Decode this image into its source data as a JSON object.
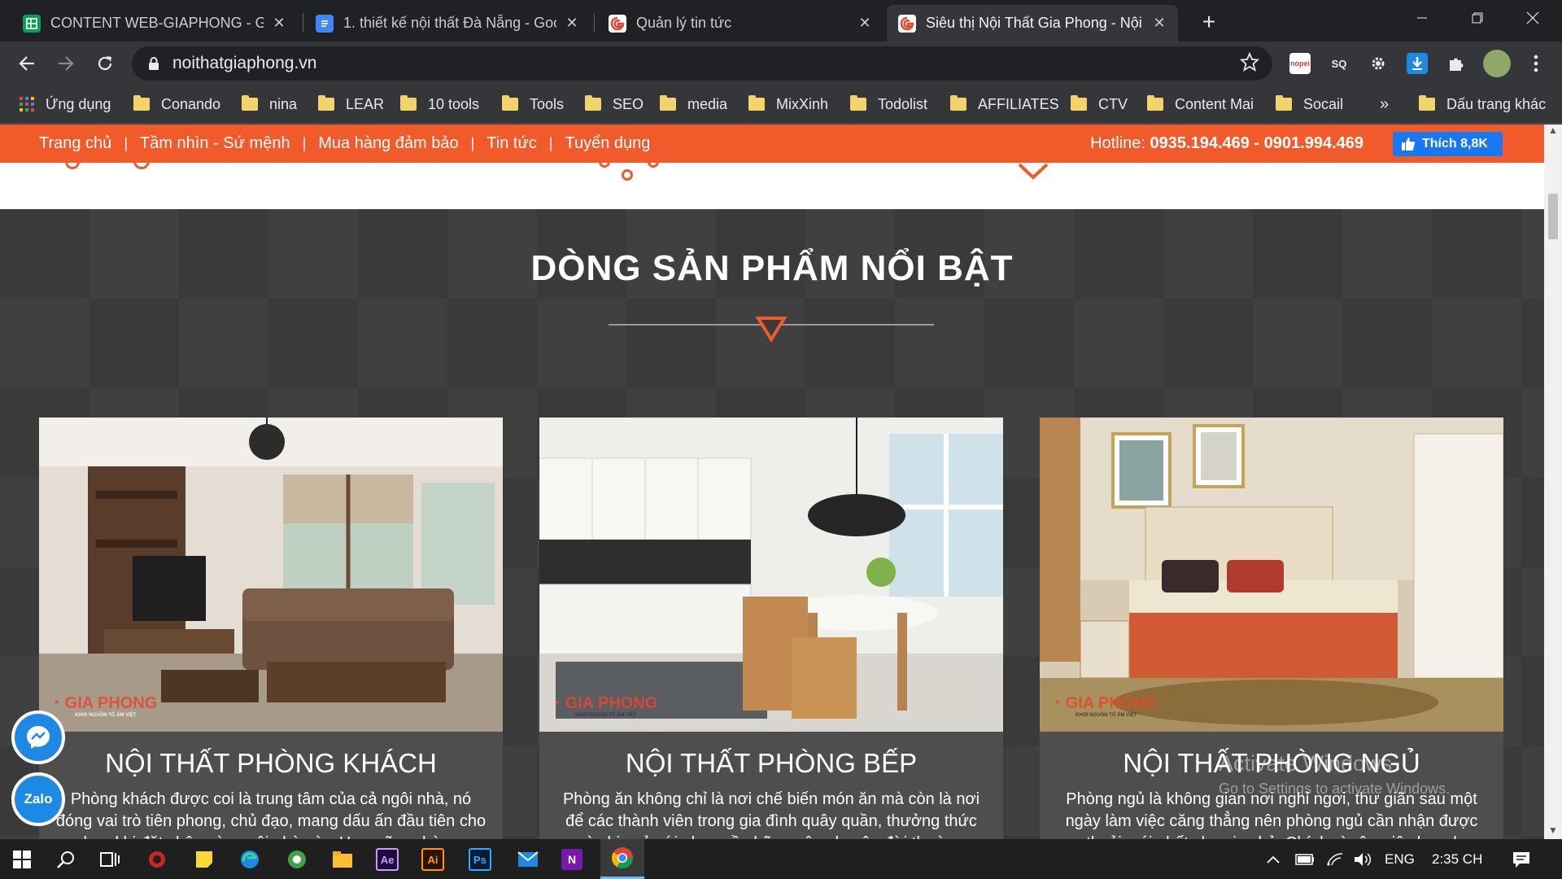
{
  "browser": {
    "tabs": [
      {
        "title": "CONTENT WEB-GIAPHONG - Goo",
        "icon": "sheets-icon",
        "color": "#0f9d58",
        "active": false
      },
      {
        "title": "1. thiết kế nội thất Đà Nẵng - Goo",
        "icon": "docs-icon",
        "color": "#4285f4",
        "active": false
      },
      {
        "title": "Quản lý tin tức",
        "icon": "giaphong-favicon-icon",
        "color": "#e8472d",
        "active": false
      },
      {
        "title": "Siêu thị Nội Thất Gia Phong - Nội",
        "icon": "giaphong-favicon-icon",
        "color": "#e8472d",
        "active": true
      }
    ],
    "tab_close_glyph": "✕",
    "new_tab_glyph": "+",
    "url": "noithatgiaphong.vn",
    "bookmarks": [
      "Ứng dụng",
      "Conando",
      "nina",
      "LEAR",
      "10 tools",
      "Tools",
      "SEO",
      "media",
      "MixXinh",
      "Todolist",
      "AFFILIATES",
      "CTV",
      "Content Mai",
      "Socail"
    ],
    "bookmarks_overflow": "»",
    "other_bookmarks": "Dấu trang khác",
    "extension_labels": {
      "nopei": "nopei",
      "seoquake": "SQ"
    }
  },
  "site": {
    "menu": [
      "Trang chủ",
      "Tầm nhìn - Sứ mệnh",
      "Mua hàng đảm bảo",
      "Tin tức",
      "Tuyển dụng"
    ],
    "menu_separator": "|",
    "hotline_label": "Hotline:",
    "hotline_numbers": "0935.194.469 - 0901.994.469",
    "fb_like_label": "Thích 8,8K",
    "section_title": "DÒNG SẢN PHẨM NỔI BẬT",
    "brand_logo_text": "GIA PHONG",
    "brand_tagline": "KHƠI NGUỒN TỔ ẤM VIỆT",
    "products": [
      {
        "title": "NỘI THẤT PHÒNG KHÁCH",
        "desc": "Phòng khách được coi là trung tâm của cả ngôi nhà, nó đóng vai trò tiên phong, chủ đạo, mang dấu ấn đầu tiên cho bạn khi đặt chân vào ngôi nhà này. Hơn nữa, phòng"
      },
      {
        "title": "NỘI THẤT PHÒNG BẾP",
        "desc": "Phòng ăn không chỉ là nơi chế biến món ăn mà còn là nơi để các thành viên trong gia đình quây quần, thưởng thức và chia sẻ với nhau về những câu chuyện đời thường"
      },
      {
        "title": "NỘI THẤT PHÒNG NGỦ",
        "desc": "Phòng ngủ là không gian nơi nghỉ ngơi, thư giãn sau một ngày làm việc căng thẳng nên phòng ngủ cần nhận được sự thoải mái nhất cho gia chủ. Chính vì vậy, việc lựa chọn"
      }
    ],
    "floating": {
      "zalo_label": "Zalo"
    },
    "accent_color": "#f15a2b"
  },
  "watermark": {
    "line1": "Activate Windows",
    "line2": "Go to Settings to activate Windows."
  },
  "taskbar": {
    "apps": [
      "windows-start-icon",
      "search-icon",
      "task-view-icon",
      "app-red-icon",
      "sticky-notes-icon",
      "edge-icon",
      "browser-green-icon",
      "file-explorer-icon",
      "after-effects-icon",
      "illustrator-icon",
      "photoshop-icon",
      "mail-icon",
      "onenote-icon",
      "chrome-icon"
    ],
    "ae_label": "Ae",
    "ai_label": "Ai",
    "ps_label": "Ps",
    "onenote_label": "N",
    "language": "ENG",
    "time": "2:35 CH"
  }
}
